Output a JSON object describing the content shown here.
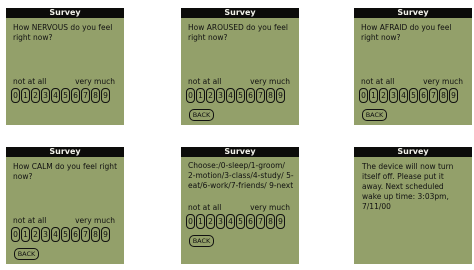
{
  "screens": [
    {
      "title": "Survey",
      "prompt": "How NERVOUS do you feel right now?",
      "low": "not at all",
      "high": "very much",
      "digits": [
        "0",
        "1",
        "2",
        "3",
        "4",
        "5",
        "6",
        "7",
        "8",
        "9"
      ]
    },
    {
      "title": "Survey",
      "prompt": "How AROUSED do you feel right now?",
      "low": "not at all",
      "high": "very much",
      "digits": [
        "0",
        "1",
        "2",
        "3",
        "4",
        "5",
        "6",
        "7",
        "8",
        "9"
      ],
      "back": "BACK"
    },
    {
      "title": "Survey",
      "prompt": "How AFRAID do you feel right now?",
      "low": "not at all",
      "high": "very much",
      "digits": [
        "0",
        "1",
        "2",
        "3",
        "4",
        "5",
        "6",
        "7",
        "8",
        "9"
      ],
      "back": "BACK"
    },
    {
      "title": "Survey",
      "prompt": "How CALM do you feel right now?",
      "low": "not at all",
      "high": "very much",
      "digits": [
        "0",
        "1",
        "2",
        "3",
        "4",
        "5",
        "6",
        "7",
        "8",
        "9"
      ],
      "back": "BACK"
    },
    {
      "title": "Survey",
      "prompt": "Choose:/0-sleep/1-groom/ 2-motion/3-class/4-study/ 5-eat/6-work/7-friends/ 9-next",
      "low": "not at all",
      "high": "very much",
      "digits": [
        "0",
        "1",
        "2",
        "3",
        "4",
        "5",
        "6",
        "7",
        "8",
        "9"
      ],
      "back": "BACK"
    },
    {
      "title": "Survey",
      "message": "The device will now turn itself off. Please put it away. Next scheduled wake up time: 3:03pm, 7/11/00"
    }
  ]
}
